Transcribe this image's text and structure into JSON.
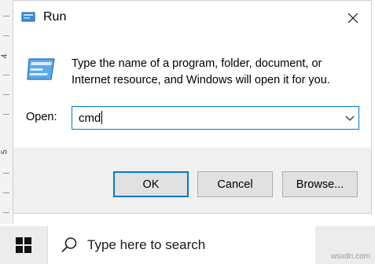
{
  "ruler": {
    "marks": [
      "4",
      "5"
    ]
  },
  "dialog": {
    "title": "Run",
    "description": "Type the name of a program, folder, document, or Internet resource, and Windows will open it for you.",
    "open_label": "Open:",
    "open_value": "cmd",
    "buttons": {
      "ok": "OK",
      "cancel": "Cancel",
      "browse": "Browse..."
    }
  },
  "taskbar": {
    "search_placeholder": "Type here to search"
  },
  "watermark": "wsxdn.com",
  "colors": {
    "accent": "#0078d7",
    "footer_bg": "#f0f0f0",
    "taskbar_bg": "#ececec"
  }
}
